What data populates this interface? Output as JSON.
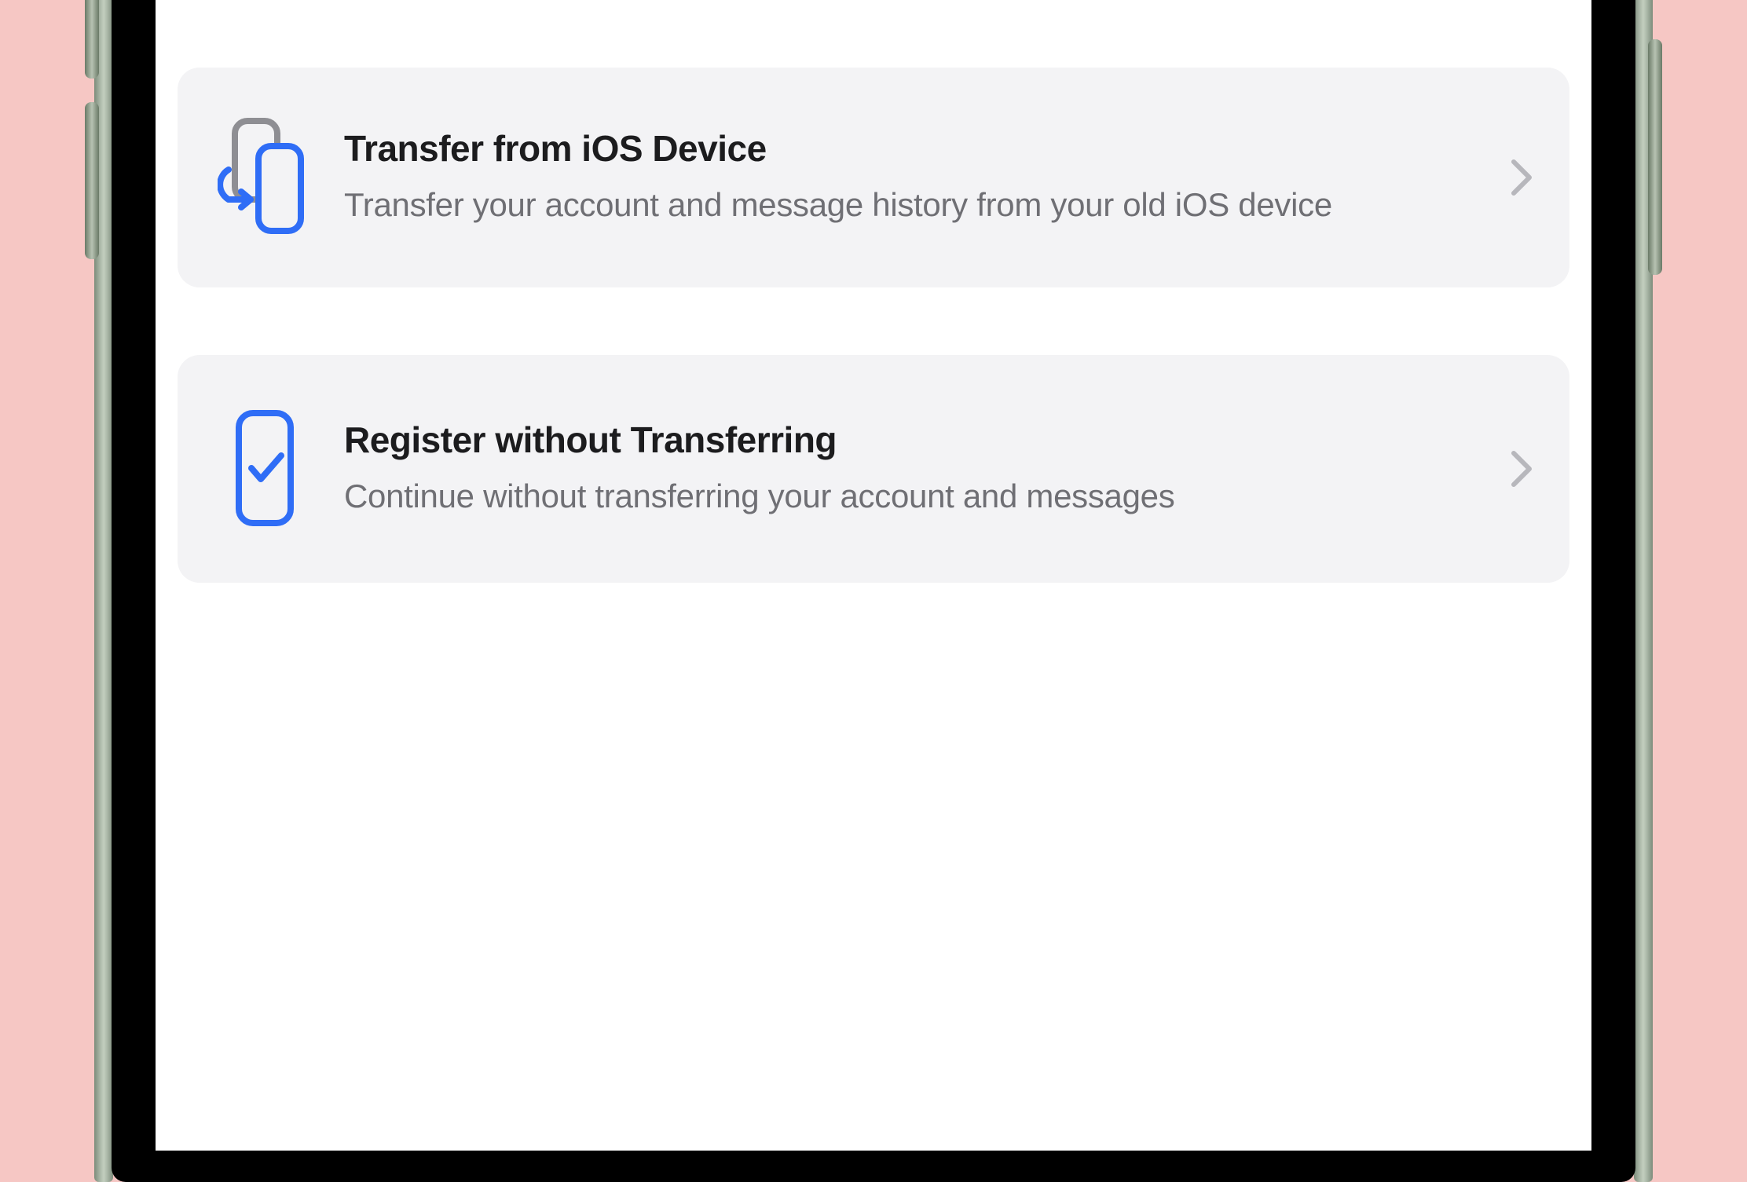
{
  "colors": {
    "accent": "#2f6df6",
    "text_primary": "#1c1c1e",
    "text_secondary": "#6f6f74",
    "card_bg": "#f3f3f5",
    "chevron": "#b7b7bc"
  },
  "options": [
    {
      "icon": "transfer-devices-icon",
      "title": "Transfer from iOS Device",
      "description": "Transfer your account and message history from your old iOS device"
    },
    {
      "icon": "device-check-icon",
      "title": "Register without Transferring",
      "description": "Continue without transferring your account and messages"
    }
  ]
}
